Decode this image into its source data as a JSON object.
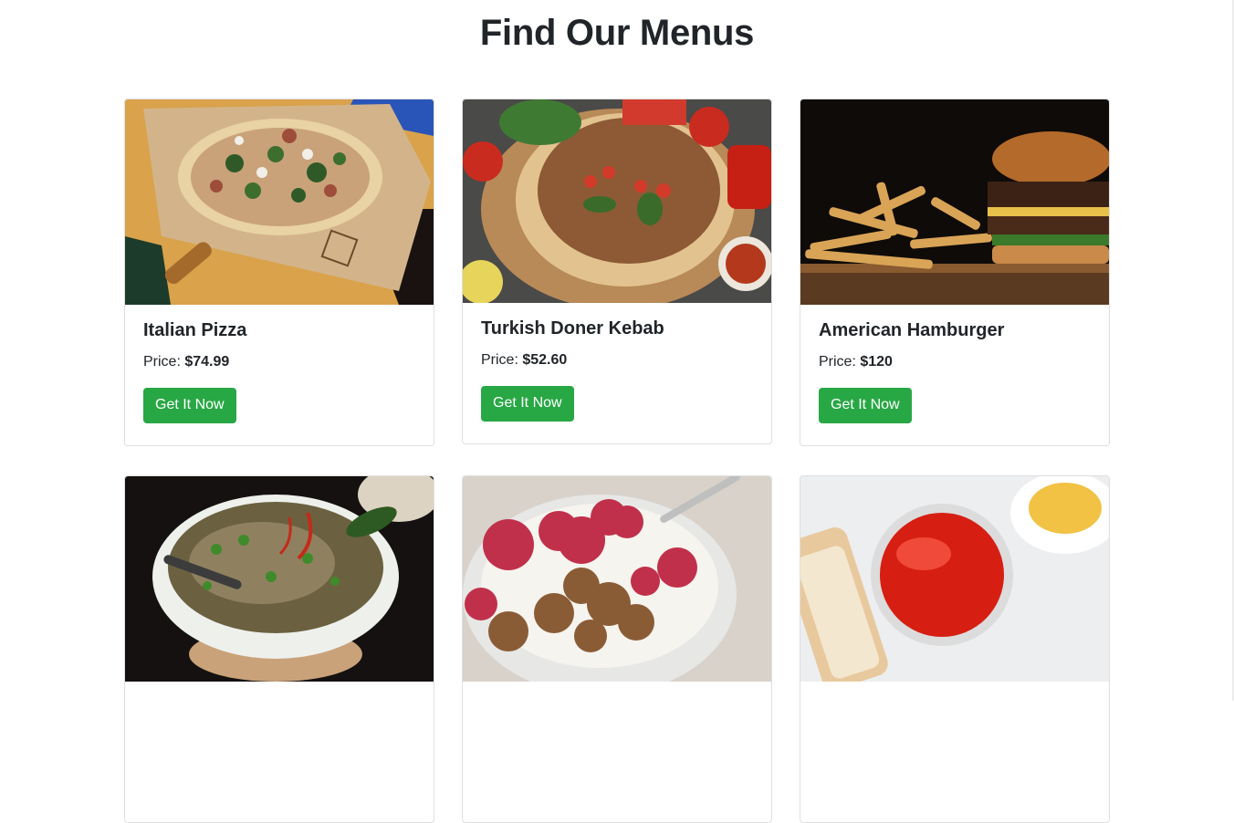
{
  "page": {
    "title": "Find Our Menus"
  },
  "colors": {
    "button_bg": "#28a745",
    "button_text": "#ffffff",
    "card_border": "#dfdfdf",
    "text": "#212529"
  },
  "menus": [
    {
      "name": "Italian Pizza",
      "price_label": "Price: ",
      "price": "$74.99",
      "button": "Get It Now",
      "image": "pizza-photo"
    },
    {
      "name": "Turkish Doner Kebab",
      "price_label": "Price: ",
      "price": "$52.60",
      "button": "Get It Now",
      "image": "lahmacun-photo"
    },
    {
      "name": "American Hamburger",
      "price_label": "Price: ",
      "price": "$120",
      "button": "Get It Now",
      "image": "burger-fries-photo"
    },
    {
      "image": "pho-soup-photo"
    },
    {
      "image": "yogurt-raspberry-photo"
    },
    {
      "image": "red-caviar-photo"
    }
  ]
}
